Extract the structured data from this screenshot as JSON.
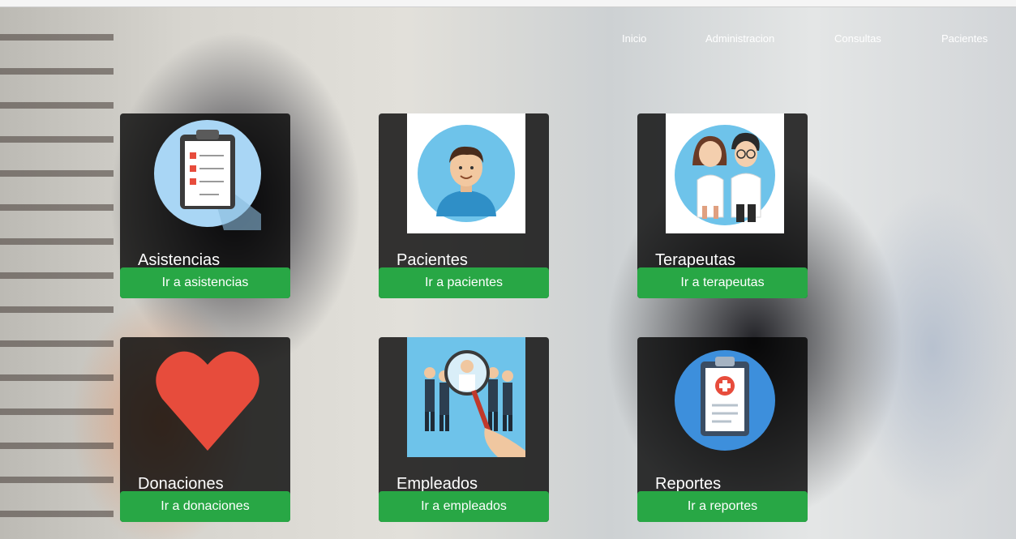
{
  "nav": {
    "items": [
      {
        "label": "Inicio"
      },
      {
        "label": "Administracion"
      },
      {
        "label": "Consultas"
      },
      {
        "label": "Pacientes"
      }
    ]
  },
  "cards": [
    {
      "title": "Asistencias",
      "button": "Ir a asistencias",
      "icon": "clipboard-checklist-icon"
    },
    {
      "title": "Pacientes",
      "button": "Ir a pacientes",
      "icon": "patient-avatar-icon"
    },
    {
      "title": "Terapeutas",
      "button": "Ir a terapeutas",
      "icon": "doctors-icon"
    },
    {
      "title": "Donaciones",
      "button": "Ir a donaciones",
      "icon": "heart-icon"
    },
    {
      "title": "Empleados",
      "button": "Ir a empleados",
      "icon": "employees-search-icon"
    },
    {
      "title": "Reportes",
      "button": "Ir a reportes",
      "icon": "medical-report-icon"
    }
  ],
  "colors": {
    "button": "#28a745",
    "card_bg": "#000000",
    "heart": "#e74c3c",
    "avatar_circle": "#6ec3ea"
  }
}
